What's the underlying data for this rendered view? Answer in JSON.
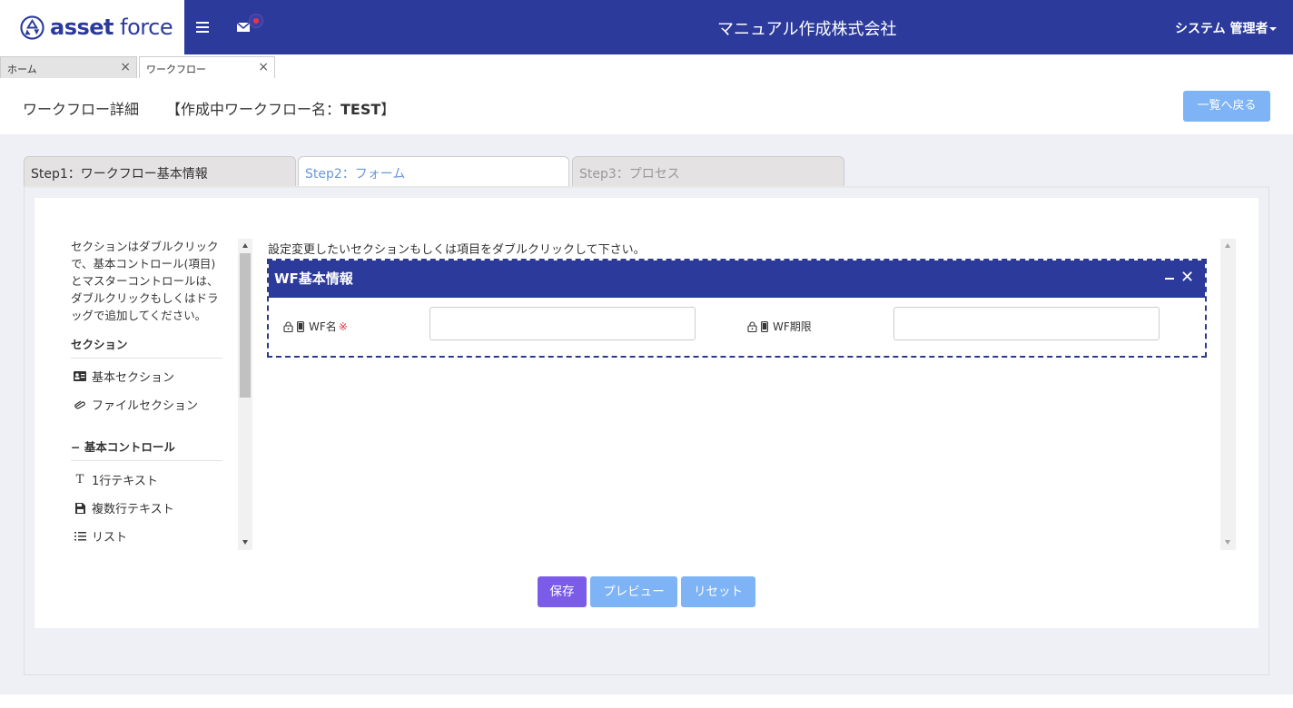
{
  "header": {
    "logo_text_bold": "asset",
    "logo_text_light": "force",
    "company_name": "マニュアル作成株式会社",
    "user_name": "システム 管理者"
  },
  "tabs": [
    {
      "label": "ホーム"
    },
    {
      "label": "ワークフロー"
    }
  ],
  "title": {
    "page_title": "ワークフロー詳細",
    "wf_prefix": "【作成中ワークフロー名：",
    "wf_name": "TEST",
    "wf_suffix": "】",
    "back_label": "一覧へ戻る"
  },
  "steps": [
    {
      "label": "Step1：ワークフロー基本情報"
    },
    {
      "label": "Step2：フォーム"
    },
    {
      "label": "Step3：プロセス"
    }
  ],
  "sidebar": {
    "help_text": "セクションはダブルクリックで、基本コントロール(項目)とマスターコントロールは、ダブルクリックもしくはドラッグで追加してください。",
    "section_heading": "セクション",
    "section_items": [
      {
        "label": "基本セクション",
        "icon": "id-card-icon"
      },
      {
        "label": "ファイルセクション",
        "icon": "paperclip-icon"
      }
    ],
    "controls_heading": "基本コントロール",
    "control_items": [
      {
        "label": "1行テキスト",
        "icon": "text-icon"
      },
      {
        "label": "複数行テキスト",
        "icon": "save-file-icon"
      },
      {
        "label": "リスト",
        "icon": "list-icon"
      }
    ]
  },
  "main": {
    "instruction": "設定変更したいセクションもしくは項目をダブルクリックして下さい。",
    "section_title": "WF基本情報",
    "fields": [
      {
        "label": "WF名",
        "required_mark": "※",
        "value": ""
      },
      {
        "label": "WF期限",
        "value": ""
      }
    ]
  },
  "actions": {
    "save": "保存",
    "preview": "プレビュー",
    "reset": "リセット"
  },
  "colors": {
    "header_bg": "#2b3a9b",
    "save_btn": "#7b5ce8",
    "secondary_btn": "#7eb3f5",
    "required": "#e0393e"
  }
}
